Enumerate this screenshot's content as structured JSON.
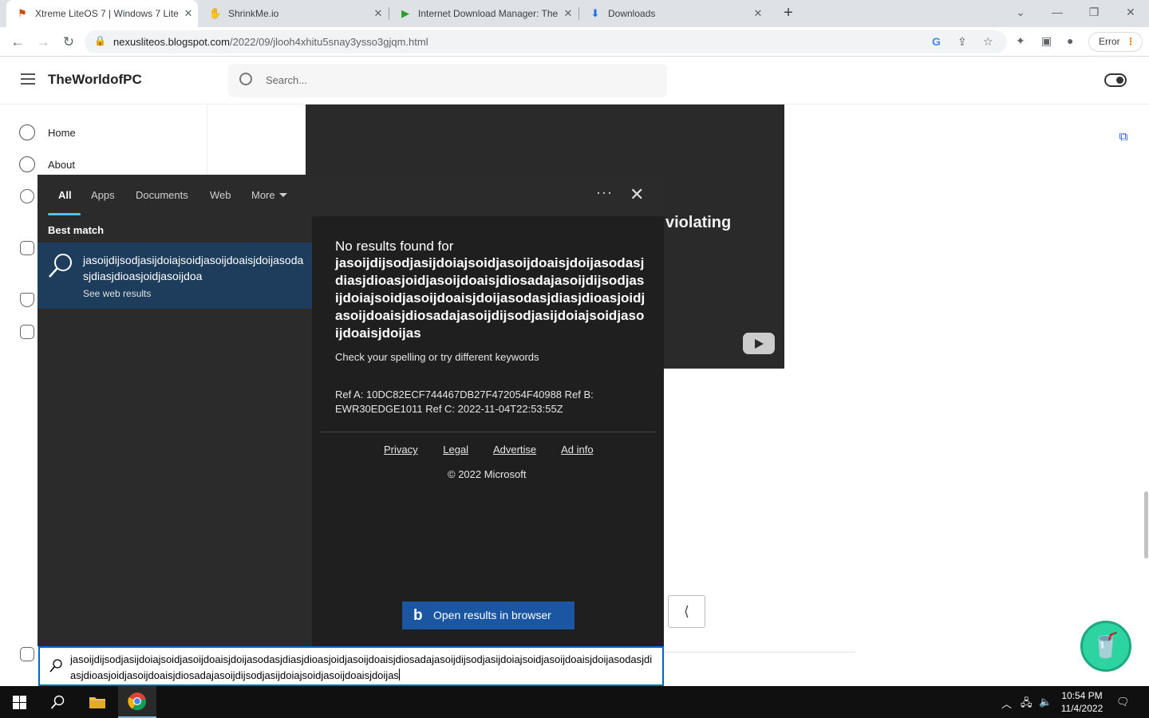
{
  "browser": {
    "tabs": [
      {
        "title": "Xtreme LiteOS 7 | Windows 7 Lite",
        "favicon": "liteos-favicon",
        "active": true
      },
      {
        "title": "ShrinkMe.io",
        "favicon": "shrinkme-favicon",
        "active": false
      },
      {
        "title": "Internet Download Manager: The",
        "favicon": "idm-favicon",
        "active": false
      },
      {
        "title": "Downloads",
        "favicon": "download-icon",
        "active": false
      }
    ],
    "url_host": "nexusliteos.blogspot.com",
    "url_path": "/2022/09/jlooh4xhitu5snay3ysso3gjqm.html",
    "error_label": "Error"
  },
  "site": {
    "brand": "TheWorldofPC",
    "search_placeholder": "Search...",
    "nav": [
      {
        "label": "Home",
        "icon": "home-icon"
      },
      {
        "label": "About",
        "icon": "people-icon"
      }
    ],
    "video_caption_fragment": "violating"
  },
  "search_panel": {
    "tabs": [
      "All",
      "Apps",
      "Documents",
      "Web",
      "More"
    ],
    "best_match_label": "Best match",
    "best_match_title": "jasoijdijsodjasijdoiajsoidjasoijdoaisjdoijasodasjdiasjdioasjoidjasoijdoa",
    "best_match_sub": "See web results",
    "no_results_label": "No results found for",
    "query": "jasoijdijsodjasijdoiajsoidjasoijdoaisjdoijasodasjdiasjdioasjoidjasoijdoaisjdiosadajasoijdijsodjasijdoiajsoidjasoijdoaisjdoijasodasjdiasjdioasjoidjasoijdoaisjdiosadajasoijdijsodjasijdoiajsoidjasoijdoaisjdoijas",
    "spell_hint": "Check your spelling or try different keywords",
    "refs": "Ref A: 10DC82ECF744467DB27F472054F40988 Ref B: EWR30EDGE1011 Ref C: 2022-11-04T22:53:55Z",
    "links": [
      "Privacy",
      "Legal",
      "Advertise",
      "Ad info"
    ],
    "copyright": "© 2022 Microsoft",
    "open_button": "Open results in browser",
    "input_value": "jasoijdijsodjasijdoiajsoidjasoijdoaisjdoijasodasjdiasjdioasjoidjasoijdoaisjdiosadajasoijdijsodjasijdoiajsoidjasoijdoaisjdoijasodasjdiasjdioasjoidjasoijdoaisjdiosadajasoijdijsodjasijdoiajsoidjasoijdoaisjdoijas"
  },
  "taskbar": {
    "time": "10:54 PM",
    "date": "11/4/2022"
  },
  "colors": {
    "accent": "#0067c0",
    "selected": "#1e3d5c",
    "bing_button": "#1b56a2"
  }
}
